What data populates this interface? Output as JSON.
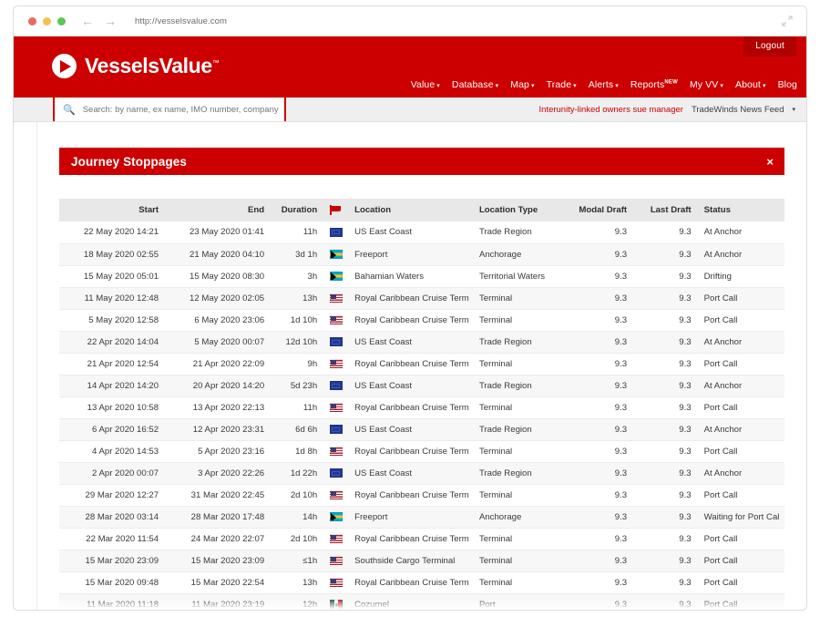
{
  "browser": {
    "url": "http://vesselsvalue.com",
    "back_icon": "back-arrow-icon",
    "forward_icon": "forward-arrow-icon",
    "expand_icon": "expand-icon"
  },
  "header": {
    "logout_label": "Logout",
    "brand_name": "VesselsValue",
    "brand_tm": "™",
    "brand_color": "#cc0000",
    "nav_items": [
      {
        "label": "Value",
        "caret": "▾",
        "badge": ""
      },
      {
        "label": "Database",
        "caret": "▾",
        "badge": ""
      },
      {
        "label": "Map",
        "caret": "▾",
        "badge": ""
      },
      {
        "label": "Trade",
        "caret": "▾",
        "badge": ""
      },
      {
        "label": "Alerts",
        "caret": "▾",
        "badge": ""
      },
      {
        "label": "Reports",
        "caret": "",
        "badge": "NEW"
      },
      {
        "label": "My VV",
        "caret": "▾",
        "badge": ""
      },
      {
        "label": "About",
        "caret": "▾",
        "badge": ""
      },
      {
        "label": "Blog",
        "caret": "",
        "badge": ""
      }
    ]
  },
  "search": {
    "placeholder": "Search: by name, ex name, IMO number, company",
    "value": "",
    "icon": "search-icon"
  },
  "news": {
    "headline": "Interunity-linked owners sue manager",
    "feed_label": "TradeWinds News Feed",
    "caret": "▾"
  },
  "panel": {
    "title": "Journey Stoppages",
    "close_label": "×"
  },
  "table": {
    "columns": [
      {
        "key": "start",
        "label": "Start"
      },
      {
        "key": "end",
        "label": "End"
      },
      {
        "key": "duration",
        "label": "Duration"
      },
      {
        "key": "flag",
        "label": ""
      },
      {
        "key": "location",
        "label": "Location"
      },
      {
        "key": "loctype",
        "label": "Location Type"
      },
      {
        "key": "modal",
        "label": "Modal Draft"
      },
      {
        "key": "last",
        "label": "Last Draft"
      },
      {
        "key": "status",
        "label": "Status"
      }
    ],
    "rows": [
      {
        "start": "22 May 2020 14:21",
        "end": "23 May 2020 01:41",
        "duration": "11h",
        "flag": "flag-blue",
        "location": "US East Coast",
        "loctype": "Trade Region",
        "modal": "9.3",
        "last": "9.3",
        "status": "At Anchor"
      },
      {
        "start": "18 May 2020 02:55",
        "end": "21 May 2020 04:10",
        "duration": "3d 1h",
        "flag": "flag-bs",
        "location": "Freeport",
        "loctype": "Anchorage",
        "modal": "9.3",
        "last": "9.3",
        "status": "At Anchor"
      },
      {
        "start": "15 May 2020 05:01",
        "end": "15 May 2020 08:30",
        "duration": "3h",
        "flag": "flag-bs",
        "location": "Bahamian Waters",
        "loctype": "Territorial Waters",
        "modal": "9.3",
        "last": "9.3",
        "status": "Drifting"
      },
      {
        "start": "11 May 2020 12:48",
        "end": "12 May 2020 02:05",
        "duration": "13h",
        "flag": "flag-us",
        "location": "Royal Caribbean Cruise Term",
        "loctype": "Terminal",
        "modal": "9.3",
        "last": "9.3",
        "status": "Port Call"
      },
      {
        "start": "5 May 2020 12:58",
        "end": "6 May 2020 23:06",
        "duration": "1d 10h",
        "flag": "flag-us",
        "location": "Royal Caribbean Cruise Term",
        "loctype": "Terminal",
        "modal": "9.3",
        "last": "9.3",
        "status": "Port Call"
      },
      {
        "start": "22 Apr 2020 14:04",
        "end": "5 May 2020 00:07",
        "duration": "12d 10h",
        "flag": "flag-blue",
        "location": "US East Coast",
        "loctype": "Trade Region",
        "modal": "9.3",
        "last": "9.3",
        "status": "At Anchor"
      },
      {
        "start": "21 Apr 2020 12:54",
        "end": "21 Apr 2020 22:09",
        "duration": "9h",
        "flag": "flag-us",
        "location": "Royal Caribbean Cruise Term",
        "loctype": "Terminal",
        "modal": "9.3",
        "last": "9.3",
        "status": "Port Call"
      },
      {
        "start": "14 Apr 2020 14:20",
        "end": "20 Apr 2020 14:20",
        "duration": "5d 23h",
        "flag": "flag-blue",
        "location": "US East Coast",
        "loctype": "Trade Region",
        "modal": "9.3",
        "last": "9.3",
        "status": "At Anchor"
      },
      {
        "start": "13 Apr 2020 10:58",
        "end": "13 Apr 2020 22:13",
        "duration": "11h",
        "flag": "flag-us",
        "location": "Royal Caribbean Cruise Term",
        "loctype": "Terminal",
        "modal": "9.3",
        "last": "9.3",
        "status": "Port Call"
      },
      {
        "start": "6 Apr 2020 16:52",
        "end": "12 Apr 2020 23:31",
        "duration": "6d 6h",
        "flag": "flag-blue",
        "location": "US East Coast",
        "loctype": "Trade Region",
        "modal": "9.3",
        "last": "9.3",
        "status": "At Anchor"
      },
      {
        "start": "4 Apr 2020 14:53",
        "end": "5 Apr 2020 23:16",
        "duration": "1d 8h",
        "flag": "flag-us",
        "location": "Royal Caribbean Cruise Term",
        "loctype": "Terminal",
        "modal": "9.3",
        "last": "9.3",
        "status": "Port Call"
      },
      {
        "start": "2 Apr 2020 00:07",
        "end": "3 Apr 2020 22:26",
        "duration": "1d 22h",
        "flag": "flag-blue",
        "location": "US East Coast",
        "loctype": "Trade Region",
        "modal": "9.3",
        "last": "9.3",
        "status": "At Anchor"
      },
      {
        "start": "29 Mar 2020 12:27",
        "end": "31 Mar 2020 22:45",
        "duration": "2d 10h",
        "flag": "flag-us",
        "location": "Royal Caribbean Cruise Term",
        "loctype": "Terminal",
        "modal": "9.3",
        "last": "9.3",
        "status": "Port Call"
      },
      {
        "start": "28 Mar 2020 03:14",
        "end": "28 Mar 2020 17:48",
        "duration": "14h",
        "flag": "flag-bs",
        "location": "Freeport",
        "loctype": "Anchorage",
        "modal": "9.3",
        "last": "9.3",
        "status": "Waiting for Port Cal"
      },
      {
        "start": "22 Mar 2020 11:54",
        "end": "24 Mar 2020 22:07",
        "duration": "2d 10h",
        "flag": "flag-us",
        "location": "Royal Caribbean Cruise Term",
        "loctype": "Terminal",
        "modal": "9.3",
        "last": "9.3",
        "status": "Port Call"
      },
      {
        "start": "15 Mar 2020 23:09",
        "end": "15 Mar 2020 23:09",
        "duration": "≤1h",
        "flag": "flag-us",
        "location": "Southside Cargo Terminal",
        "loctype": "Terminal",
        "modal": "9.3",
        "last": "9.3",
        "status": "Port Call"
      },
      {
        "start": "15 Mar 2020 09:48",
        "end": "15 Mar 2020 22:54",
        "duration": "13h",
        "flag": "flag-us",
        "location": "Royal Caribbean Cruise Term",
        "loctype": "Terminal",
        "modal": "9.3",
        "last": "9.3",
        "status": "Port Call"
      },
      {
        "start": "11 Mar 2020 11:18",
        "end": "11 Mar 2020 23:19",
        "duration": "12h",
        "flag": "flag-mx",
        "location": "Cozumel",
        "loctype": "Port",
        "modal": "9.3",
        "last": "9.3",
        "status": "Port Call"
      }
    ]
  }
}
